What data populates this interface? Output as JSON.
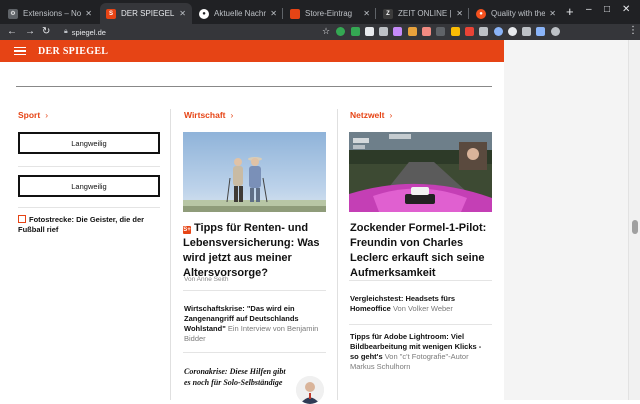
{
  "tabs": [
    {
      "title": "Extensions – No S",
      "favicon_color": "#5f6368",
      "active": false
    },
    {
      "title": "DER SPIEGEL | Onl",
      "favicon_color": "#e64415",
      "active": true
    },
    {
      "title": "Aktuelle Nachrich",
      "favicon_color": "#ffffff",
      "active": false
    },
    {
      "title": "Store-Eintrag",
      "favicon_color": "#e64415",
      "active": false
    },
    {
      "title": "ZEIT ONLINE | Na",
      "favicon_color": "#3c3c3c",
      "active": false
    },
    {
      "title": "Quality with the s",
      "favicon_color": "#f4511e",
      "active": false
    }
  ],
  "toolbar": {
    "url": "spiegel.de"
  },
  "extension_colors": [
    "#bdc1c6",
    "#34a853",
    "#34a853",
    "#e8eaed",
    "#bdc1c6",
    "#c58af9",
    "#e8a23c",
    "#f28b82",
    "#5f6368",
    "#fbbc04",
    "#ea4335",
    "#bdc1c6",
    "#8ab4f8",
    "#e8eaed",
    "#bdc1c6",
    "#8ab4f8",
    "#bdc1c6"
  ],
  "brand": "DER SPIEGEL",
  "colors": {
    "accent": "#e64415",
    "chrome_dark": "#202124",
    "chrome_toolbar": "#35363a"
  },
  "sport": {
    "heading": "Sport",
    "button1": "Langweilig",
    "button2": "Langweilig",
    "headline": "Fotostrecke: Die Geister, die der Fußball rief"
  },
  "wirtschaft": {
    "heading": "Wirtschaft",
    "lead_title": "Tipps für Renten- und Lebensversicherung: Was wird jetzt aus meiner Altersvorsorge?",
    "lead_byline": "Von Anne Seith",
    "item1_title": "Wirtschaftskrise: \"Das wird ein Zangenangriff auf Deutschlands Wohlstand\"",
    "item1_author": "Ein Interview von Benjamin Bidder",
    "item2_title": "Coronakrise: Diese Hilfen gibt es noch für Solo-Selbständige"
  },
  "netzwelt": {
    "heading": "Netzwelt",
    "lead_title": "Zockender Formel-1-Pilot: Freundin von Charles Leclerc erkauft sich seine Aufmerksamkeit",
    "item1_title": "Vergleichstest: Headsets fürs Homeoffice",
    "item1_author": "Von Volker Weber",
    "item2_title": "Tipps für Adobe Lightroom: Viel Bildbearbeitung mit wenigen Klicks - so geht's",
    "item2_author": "Von \"c't Fotografie\"-Autor Markus Schulhorn"
  }
}
